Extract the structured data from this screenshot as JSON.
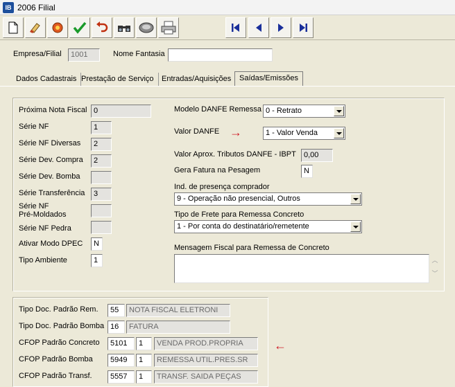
{
  "window": {
    "icon": "IB",
    "title": "2006 Filial"
  },
  "toolbar": {
    "buttons": [
      "new-doc-icon",
      "clear-icon",
      "settings-icon",
      "confirm-icon",
      "undo-icon",
      "search-icon",
      "database-icon",
      "print-icon"
    ],
    "nav": [
      "first-record-icon",
      "previous-record-icon",
      "next-record-icon",
      "last-record-icon"
    ]
  },
  "header": {
    "empresa_label": "Empresa/Filial",
    "empresa_value": "1001",
    "fantasia_label": "Nome Fantasia",
    "fantasia_value": ""
  },
  "tabs": [
    {
      "label": "Dados Cadastrais"
    },
    {
      "label": "Prestação de Serviço"
    },
    {
      "label": "Entradas/Aquisições"
    },
    {
      "label": "Saídas/Emissões",
      "active": true
    }
  ],
  "left": {
    "proxima_nf": {
      "label": "Próxima Nota Fiscal",
      "value": "0"
    },
    "serie_nf": {
      "label": "Série NF",
      "value": "1"
    },
    "serie_nf_diversas": {
      "label": "Série NF Diversas",
      "value": "2"
    },
    "serie_dev_compra": {
      "label": "Série Dev. Compra",
      "value": "2"
    },
    "serie_dev_bomba": {
      "label": "Série Dev. Bomba",
      "value": ""
    },
    "serie_transferencia": {
      "label": "Série Transferência",
      "value": "3"
    },
    "serie_nf_premoldados": {
      "label1": "Série NF",
      "label2": "Pré-Moldados",
      "value": ""
    },
    "serie_nf_pedra": {
      "label": "Série NF Pedra",
      "value": ""
    },
    "ativar_dpec": {
      "label": "Ativar Modo DPEC",
      "value": "N"
    },
    "tipo_ambiente": {
      "label": "Tipo Ambiente",
      "value": "1"
    }
  },
  "right": {
    "modelo_danfe": {
      "label": "Modelo DANFE Remessa",
      "value": "0 - Retrato"
    },
    "valor_danfe": {
      "label": "Valor DANFE",
      "value": "1 - Valor Venda"
    },
    "valor_aprox": {
      "label": "Valor Aprox. Tributos DANFE - IBPT",
      "value": "0,00"
    },
    "gera_fatura": {
      "label": "Gera Fatura na Pesagem",
      "value": "N"
    },
    "ind_presenca": {
      "label": "Ind. de presença comprador",
      "value": "9 - Operação não presencial, Outros"
    },
    "tipo_frete": {
      "label": "Tipo de Frete para Remessa Concreto",
      "value": "1 - Por conta do destinatário/remetente"
    },
    "mensagem_fiscal": {
      "label": "Mensagem Fiscal para Remessa de Concreto",
      "value": ""
    }
  },
  "bottom": {
    "tipo_doc_rem": {
      "label": "Tipo Doc. Padrão Rem.",
      "code": "55",
      "desc": "NOTA FISCAL ELETRONI"
    },
    "tipo_doc_bomba": {
      "label": "Tipo Doc. Padrão Bomba",
      "code": "16",
      "desc": "FATURA"
    },
    "cfop_concreto": {
      "label": "CFOP Padrão Concreto",
      "code": "5101",
      "seq": "1",
      "desc": "VENDA PROD.PROPRIA"
    },
    "cfop_bomba": {
      "label": "CFOP Padrão Bomba",
      "code": "5949",
      "seq": "1",
      "desc": "REMESSA UTIL.PRES.SR"
    },
    "cfop_transf": {
      "label": "CFOP Padrão Transf.",
      "code": "5557",
      "seq": "1",
      "desc": "TRANSF. SAIDA PEÇAS"
    }
  },
  "colors": {
    "accent_arrow": "#d0202a",
    "nav_blue": "#1a2f9a"
  }
}
